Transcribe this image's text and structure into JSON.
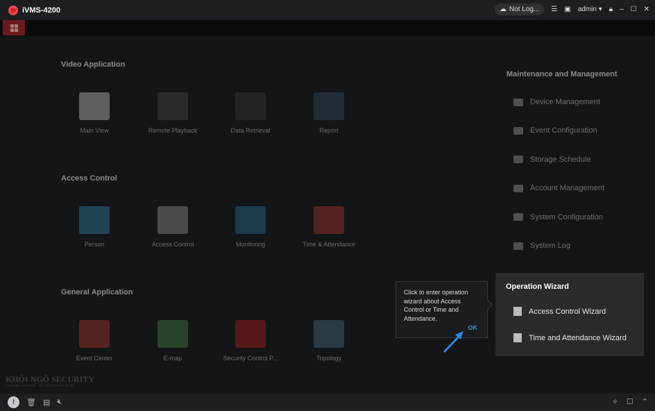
{
  "app": {
    "title": "iVMS-4200",
    "cloud_status": "Not Log...",
    "user": "admin"
  },
  "sections": [
    {
      "title": "Video Application",
      "items": [
        "Main View",
        "Remote Playback",
        "Data Retrieval",
        "Report"
      ]
    },
    {
      "title": "Access Control",
      "items": [
        "Person",
        "Access Control",
        "Monitoring",
        "Time & Attendance"
      ]
    },
    {
      "title": "General Application",
      "items": [
        "Event Center",
        "E-map",
        "Security Control P...",
        "Topology"
      ]
    }
  ],
  "maintenance": {
    "title": "Maintenance and Management",
    "items": [
      "Device Management",
      "Event Configuration",
      "Storage Schedule",
      "Account Management",
      "System Configuration",
      "System Log"
    ]
  },
  "wizard": {
    "title": "Operation Wizard",
    "items": [
      "Access Control Wizard",
      "Time and Attendance Wizard"
    ]
  },
  "tooltip": {
    "text": "Click to enter operation wizard about Access Control or Time and Attendance.",
    "ok": "OK"
  },
  "watermark": {
    "name": "KHÔI NGÔ SECURITY",
    "tagline": "CAMERA AN NINH - HỆ THỐNG BÁO ĐỘNG"
  },
  "colors": {
    "accent": "#d7262b",
    "link": "#3d8fd9"
  }
}
